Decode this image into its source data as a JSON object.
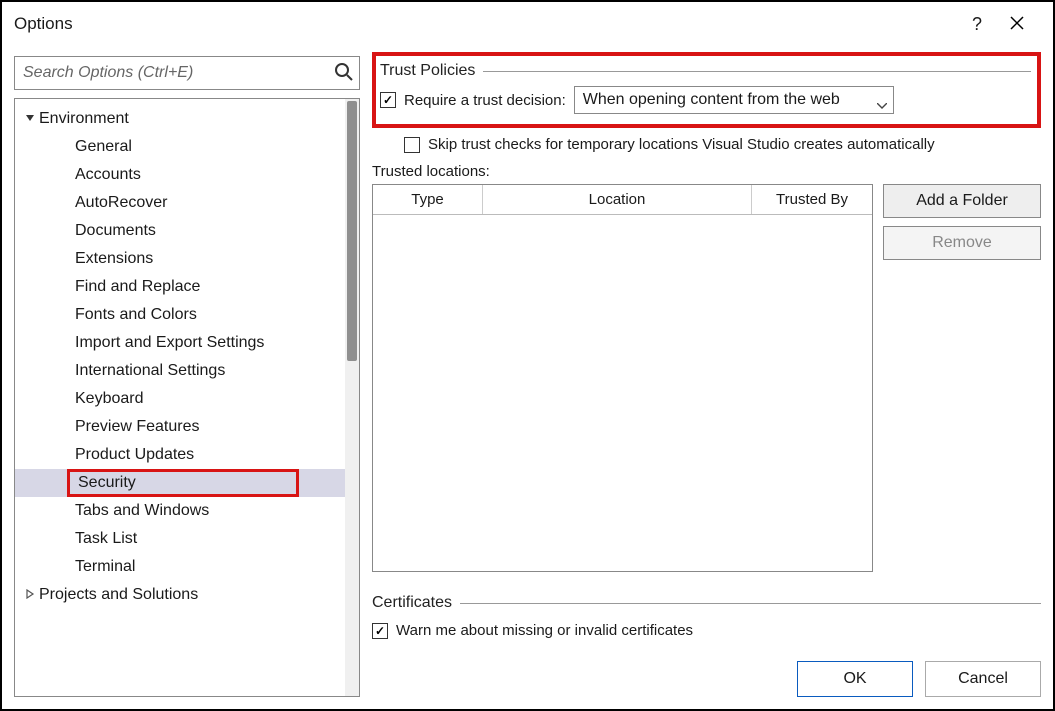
{
  "window": {
    "title": "Options",
    "help": "?",
    "close": "✕"
  },
  "search": {
    "placeholder": "Search Options (Ctrl+E)"
  },
  "tree": {
    "top": {
      "label": "Environment",
      "expanded": true
    },
    "children": [
      "General",
      "Accounts",
      "AutoRecover",
      "Documents",
      "Extensions",
      "Find and Replace",
      "Fonts and Colors",
      "Import and Export Settings",
      "International Settings",
      "Keyboard",
      "Preview Features",
      "Product Updates",
      "Security",
      "Tabs and Windows",
      "Task List",
      "Terminal"
    ],
    "selected": "Security",
    "second": {
      "label": "Projects and Solutions",
      "expanded": false
    }
  },
  "trust": {
    "group": "Trust Policies",
    "require_label": "Require a trust decision:",
    "require_checked": true,
    "dropdown_value": "When opening content from the web",
    "skip_label": "Skip trust checks for temporary locations Visual Studio creates automatically",
    "skip_checked": false,
    "locations_label": "Trusted locations:",
    "columns": {
      "type": "Type",
      "location": "Location",
      "trusted_by": "Trusted By"
    },
    "add_button": "Add a Folder",
    "remove_button": "Remove"
  },
  "certs": {
    "group": "Certificates",
    "warn_label": "Warn me about missing or invalid certificates",
    "warn_checked": true
  },
  "buttons": {
    "ok": "OK",
    "cancel": "Cancel"
  }
}
